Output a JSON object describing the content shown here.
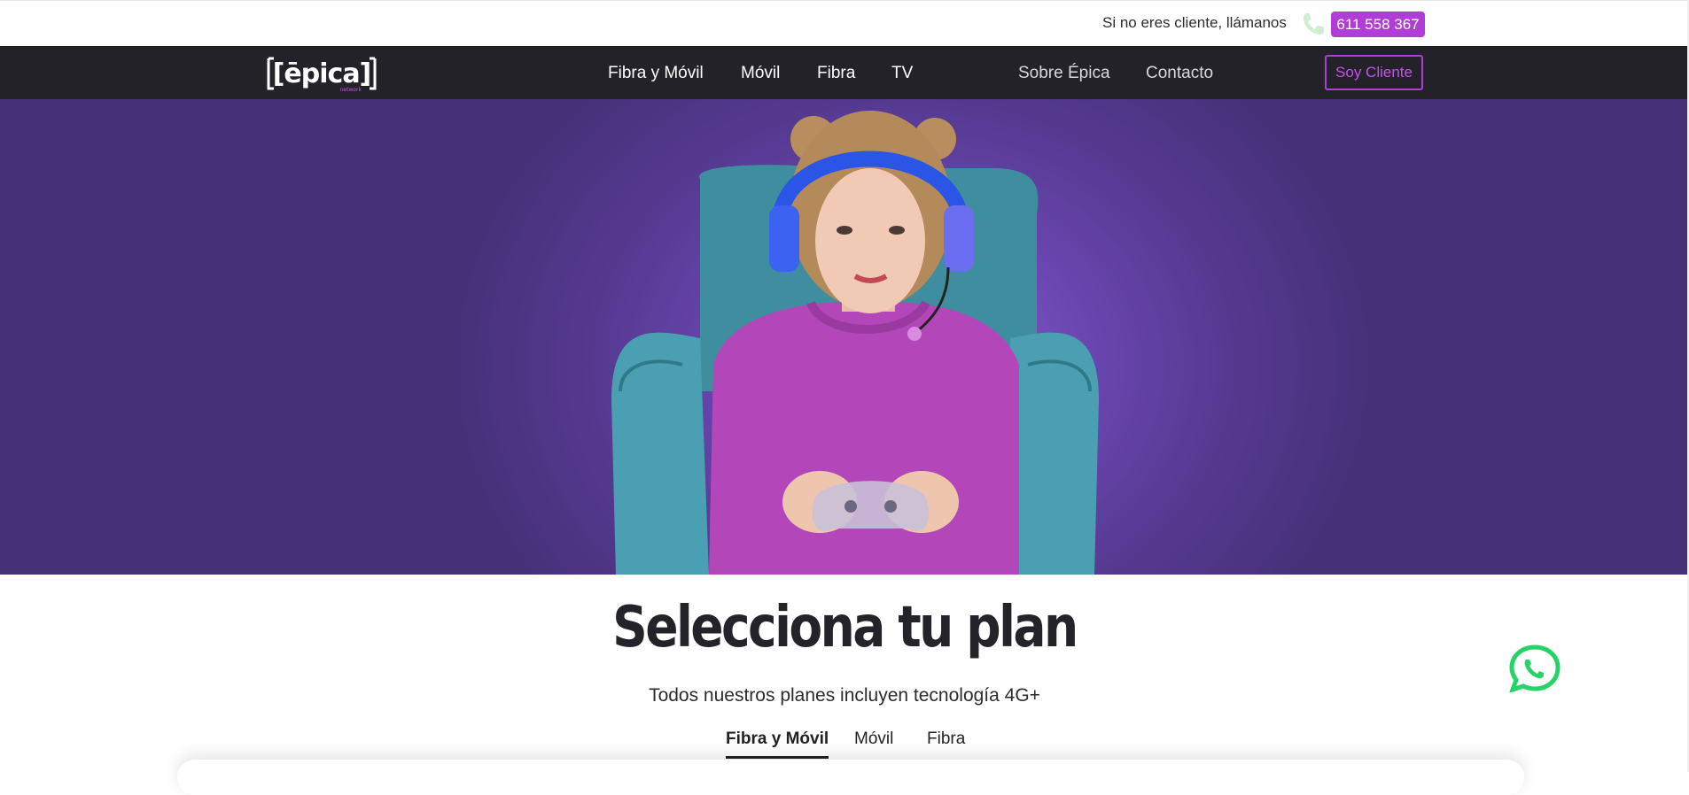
{
  "topbar": {
    "call_text": "Si no eres cliente, llámanos",
    "phone_number": "611 558 367",
    "phone_icon": "phone-icon"
  },
  "nav": {
    "logo_text": "[ēpica]",
    "logo_subtext": "network",
    "items": [
      "Fibra y Móvil",
      "Móvil",
      "Fibra",
      "TV"
    ],
    "secondary_items": [
      "Sobre Épica",
      "Contacto"
    ],
    "client_button": "Soy Cliente"
  },
  "colors": {
    "accent": "#b03ed6",
    "nav_bg": "#232228",
    "hero_purple": "#6a46b0",
    "whatsapp": "#25d366"
  },
  "plans": {
    "title": "Selecciona tu plan",
    "subtitle": "Todos nuestros planes incluyen tecnología 4G+",
    "tabs": [
      "Fibra y Móvil",
      "Móvil",
      "Fibra"
    ],
    "active_tab": "Fibra y Móvil"
  },
  "floating": {
    "whatsapp_icon": "whatsapp-icon"
  }
}
